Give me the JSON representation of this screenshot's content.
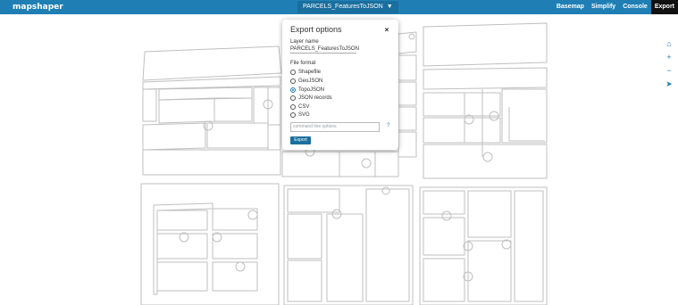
{
  "app": {
    "logo": "mapshaper"
  },
  "layer_selector": {
    "label": "PARCELS_FeaturesToJSON",
    "caret": "▼"
  },
  "menu": [
    {
      "label": "Basemap",
      "active": false
    },
    {
      "label": "Simplify",
      "active": false
    },
    {
      "label": "Console",
      "active": false
    },
    {
      "label": "Export",
      "active": true
    }
  ],
  "map_tools": [
    {
      "icon": "home-icon",
      "glyph": "⌂"
    },
    {
      "icon": "zoom-in-icon",
      "glyph": "+"
    },
    {
      "icon": "zoom-out-icon",
      "glyph": "−"
    },
    {
      "icon": "pointer-icon",
      "glyph": "➤"
    }
  ],
  "export_panel": {
    "title": "Export options",
    "close_glyph": "×",
    "layer_name_label": "Layer name",
    "layer_name_value": "PARCELS_FeaturesToJSON",
    "file_format_label": "File format",
    "formats": [
      {
        "label": "Shapefile",
        "selected": false
      },
      {
        "label": "GeoJSON",
        "selected": false
      },
      {
        "label": "TopoJSON",
        "selected": true
      },
      {
        "label": "JSON records",
        "selected": false
      },
      {
        "label": "CSV",
        "selected": false
      },
      {
        "label": "SVG",
        "selected": false
      }
    ],
    "command_placeholder": "command line options",
    "help_glyph": "?",
    "export_button": "Export"
  },
  "colors": {
    "topbar": "#1f7fb4",
    "accent": "#1a6f9e",
    "active_menu": "#111111",
    "parcel_stroke": "#bfbfbf"
  }
}
